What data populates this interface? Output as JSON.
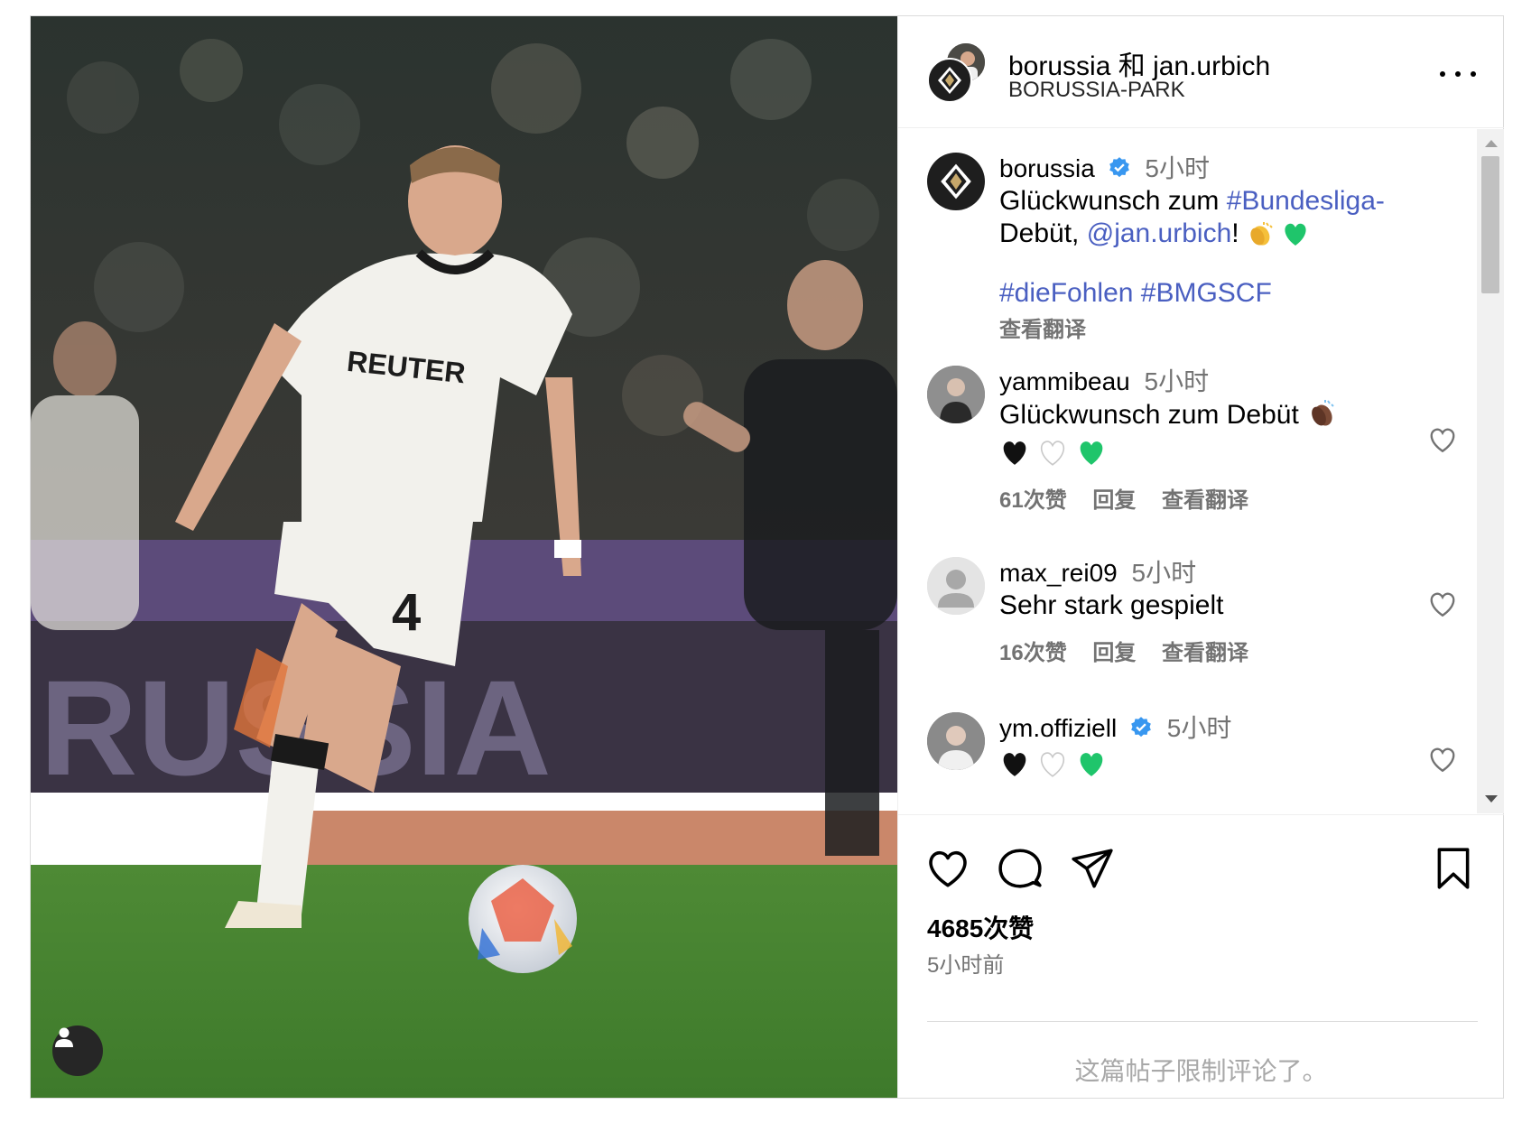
{
  "header": {
    "title": "borussia 和 jan.urbich",
    "location": "BORUSSIA-PARK"
  },
  "caption": {
    "username": "borussia",
    "time": "5小时",
    "text_before": "Glückwunsch zum ",
    "hashtag_bundesliga": "#Bundesliga-",
    "text_debut": "Debüt, ",
    "mention": "@jan.urbich",
    "exclaim": "!",
    "hashtags": "#dieFohlen #BMGSCF",
    "translate": "查看翻译"
  },
  "comments": [
    {
      "username": "yammibeau",
      "time": "5小时",
      "text": "Glückwunsch zum Debüt",
      "likes": "61次赞",
      "reply": "回复",
      "translate": "查看翻译"
    },
    {
      "username": "max_rei09",
      "time": "5小时",
      "text": "Sehr stark gespielt",
      "likes": "16次赞",
      "reply": "回复",
      "translate": "查看翻译"
    },
    {
      "username": "ym.offiziell",
      "time": "5小时",
      "text": "",
      "likes": "",
      "reply": "",
      "translate": ""
    }
  ],
  "footer": {
    "likes": "4685次赞",
    "posted": "5小时前",
    "restricted": "这篇帖子限制评论了。"
  },
  "photo": {
    "jersey_sponsor": "REUTER",
    "jersey_number": "4",
    "banner": "RUSSIA"
  },
  "colors": {
    "verified": "#3897f0",
    "link": "#4a5fc1",
    "green_heart": "#1fc56b",
    "muted": "#737373"
  },
  "icons": [
    "more-icon",
    "verified-icon",
    "heart-icon",
    "comment-icon",
    "share-icon",
    "bookmark-icon",
    "user-tag-icon"
  ]
}
